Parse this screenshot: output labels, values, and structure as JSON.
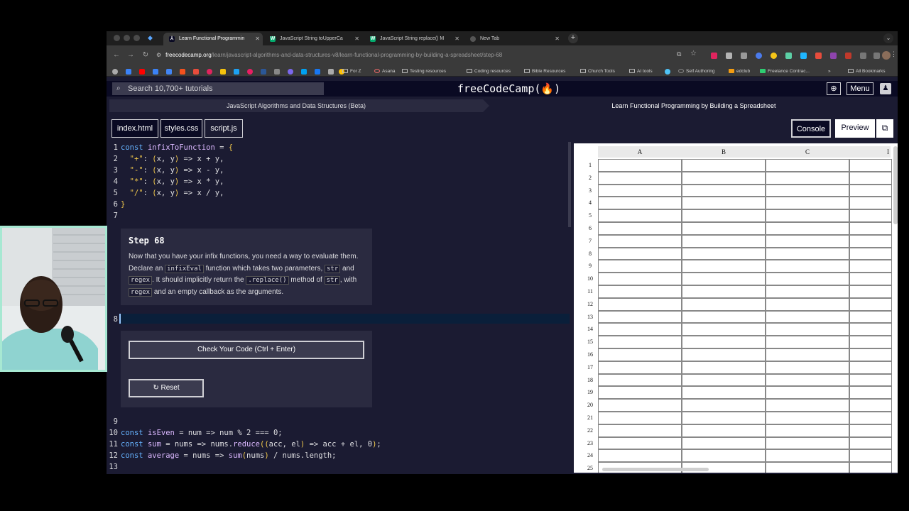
{
  "browser": {
    "tabs": [
      {
        "label": "Learn Functional Programmin",
        "favicon": "fcc-icon",
        "active": true
      },
      {
        "label": "JavaScript String toUpperCa",
        "favicon": "w-icon",
        "active": false
      },
      {
        "label": "JavaScript String replace() M",
        "favicon": "w-icon",
        "active": false
      },
      {
        "label": "New Tab",
        "favicon": "chrome-icon",
        "active": false
      }
    ],
    "url_host": "freecodecamp.org",
    "url_path": "/learn/javascript-algorithms-and-data-structures-v8/learn-functional-programming-by-building-a-spreadsheet/step-68",
    "bookmarks": [
      "For Z",
      "Asana",
      "Testing resources",
      "Coding resources",
      "Bible Resources",
      "Church Tools",
      "AI tools",
      "Self Authoring",
      "edclub",
      "Freelance Contrac...",
      "All Bookmarks"
    ],
    "more_bookmarks": "»"
  },
  "fcc": {
    "search_placeholder": "Search 10,700+ tutorials",
    "logo": "freeCodeCamp(🔥)",
    "menu_label": "Menu",
    "breadcrumb_left": "JavaScript Algorithms and Data Structures (Beta)",
    "breadcrumb_right": "Learn Functional Programming by Building a Spreadsheet"
  },
  "editor_tabs": [
    "index.html",
    "styles.css",
    "script.js"
  ],
  "right_tabs": {
    "console": "Console",
    "preview": "Preview"
  },
  "code_lines_top": [
    {
      "n": "1",
      "text": "const infixToFunction = {"
    },
    {
      "n": "2",
      "text": "  \"+\": (x, y) => x + y,"
    },
    {
      "n": "3",
      "text": "  \"-\": (x, y) => x - y,"
    },
    {
      "n": "4",
      "text": "  \"*\": (x, y) => x * y,"
    },
    {
      "n": "5",
      "text": "  \"/\": (x, y) => x / y,"
    },
    {
      "n": "6",
      "text": "}"
    },
    {
      "n": "7",
      "text": ""
    }
  ],
  "step": {
    "title": "Step 68",
    "desc_1": "Now that you have your infix functions, you need a way to evaluate them. Declare an ",
    "code_1": "infixEval",
    "desc_2": " function which takes two parameters, ",
    "code_2": "str",
    "desc_3": " and ",
    "code_3": "regex",
    "desc_4": ". It should implicitly return the ",
    "code_4": ".replace()",
    "desc_5": " method of ",
    "code_5": "str",
    "desc_6": ", with ",
    "code_6": "regex",
    "desc_7": " and an empty callback as the arguments."
  },
  "active_line_number": "8",
  "check_button": "Check Your Code (Ctrl + Enter)",
  "reset_button": "Reset",
  "code_lines_bottom": [
    {
      "n": "9",
      "text": ""
    },
    {
      "n": "10",
      "text": "const isEven = num => num % 2 === 0;"
    },
    {
      "n": "11",
      "text": "const sum = nums => nums.reduce((acc, el) => acc + el, 0);"
    },
    {
      "n": "12",
      "text": "const average = nums => sum(nums) / nums.length;"
    },
    {
      "n": "13",
      "text": ""
    }
  ],
  "spreadsheet": {
    "columns": [
      "A",
      "B",
      "C",
      "I"
    ],
    "rows": [
      "1",
      "2",
      "3",
      "4",
      "5",
      "6",
      "7",
      "8",
      "9",
      "10",
      "11",
      "12",
      "13",
      "14",
      "15",
      "16",
      "17",
      "18",
      "19",
      "20",
      "21",
      "22",
      "23",
      "24",
      "25"
    ]
  }
}
